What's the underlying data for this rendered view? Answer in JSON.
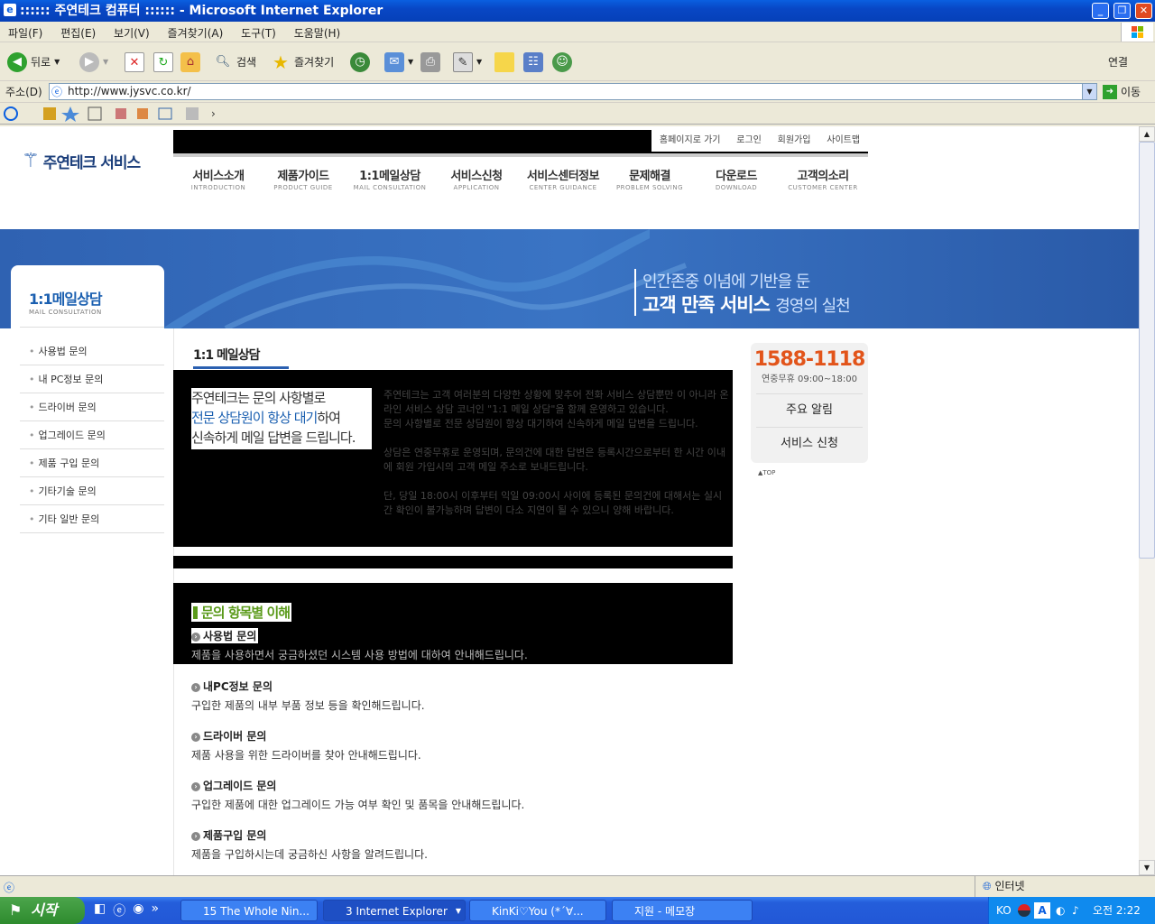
{
  "window": {
    "title": ":::::: 주연테크 컴퓨터 :::::: - Microsoft Internet Explorer"
  },
  "menu": [
    "파일(F)",
    "편집(E)",
    "보기(V)",
    "즐겨찾기(A)",
    "도구(T)",
    "도움말(H)"
  ],
  "toolbar": {
    "back": "뒤로",
    "search": "검색",
    "favorites": "즐겨찾기",
    "connect": "연결"
  },
  "address": {
    "label": "주소(D)",
    "url": "http://www.jysvc.co.kr/",
    "go": "이동"
  },
  "site": {
    "logo": "주연테크 서비스",
    "util": [
      "홈페이지로 가기",
      "로그인",
      "회원가입",
      "사이트맵"
    ],
    "nav": [
      {
        "ko": "서비스소개",
        "en": "INTRODUCTION"
      },
      {
        "ko": "제품가이드",
        "en": "PRODUCT GUIDE"
      },
      {
        "ko": "1:1메일상담",
        "en": "MAIL CONSULTATION"
      },
      {
        "ko": "서비스신청",
        "en": "APPLICATION"
      },
      {
        "ko": "서비스센터정보",
        "en": "CENTER GUIDANCE"
      },
      {
        "ko": "문제해결",
        "en": "PROBLEM SOLVING"
      },
      {
        "ko": "다운로드",
        "en": "DOWNLOAD"
      },
      {
        "ko": "고객의소리",
        "en": "CUSTOMER CENTER"
      }
    ],
    "banner": {
      "line1": "인간존중 이념에 기반을 둔",
      "line2a": "고객 만족 서비스",
      "line2b": "경영의 실천"
    },
    "side": {
      "title": "1:1메일상담",
      "subtitle": "MAIL CONSULTATION",
      "items": [
        "사용법 문의",
        "내 PC정보 문의",
        "드라이버 문의",
        "업그레이드 문의",
        "제품 구입 문의",
        "기타기술 문의",
        "기타 일반 문의"
      ]
    },
    "content": {
      "title": "1:1 메일상담",
      "lead1": "주연테크는 문의 사항별로",
      "lead2a": "전문 상담원이 항상 대기",
      "lead2b": "하여",
      "lead3": "신속하게 메일 답변을 드립니다.",
      "p1": "주연테크는 고객 여러분의 다양한 상황에 맞추어 전화 서비스 상담뿐만 이 아니라 온라인 서비스 상담 코너인 \"1:1 메일 상담\"을 함께 운영하고 있습니다.",
      "p2": "문의 사항별로 전문 상담원이 항상 대기하여 신속하게 메일 답변을 드립니다.",
      "p3": "상담은 연중무휴로 운영되며, 문의건에 대한 답변은 등록시간으로부터 한 시간 이내에 회원 가입시의 고객 메일 주소로 보내드립니다.",
      "p4": "단, 당일 18:00시 이후부터 익일 09:00시 사이에 등록된 문의건에 대해서는 실시간 확인이 불가능하며 답변이 다소 지연이 될 수 있으니 양해 바랍니다.",
      "section": "문의 항목별 이해",
      "items": [
        {
          "t": "사용법 문의",
          "d": "제품을 사용하면서 궁금하셨던 시스템 사용 방법에 대하여 안내해드립니다."
        },
        {
          "t": "내PC정보 문의",
          "d": "구입한 제품의 내부 부품 정보 등을 확인해드립니다."
        },
        {
          "t": "드라이버 문의",
          "d": "제품 사용을 위한 드라이버를 찾아 안내해드립니다."
        },
        {
          "t": "업그레이드 문의",
          "d": "구입한 제품에 대한 업그레이드 가능 여부 확인 및 품목을 안내해드립니다."
        },
        {
          "t": "제품구입 문의",
          "d": "제품을 구입하시는데 궁금하신 사항을 알려드립니다."
        }
      ]
    },
    "quick": {
      "phone": "1588-1118",
      "hours": "연중무휴 09:00~18:00",
      "notice": "주요 알림",
      "apply": "서비스 신청",
      "top": "▲TOP"
    }
  },
  "status": {
    "zone": "인터넷"
  },
  "taskbar": {
    "start": "시작",
    "tasks": [
      "15 The Whole Nin...",
      "3 Internet Explorer",
      "KinKi♡You (*´∀...",
      "지원 - 메모장"
    ],
    "lang": "KO",
    "clock": "오전 2:22"
  }
}
